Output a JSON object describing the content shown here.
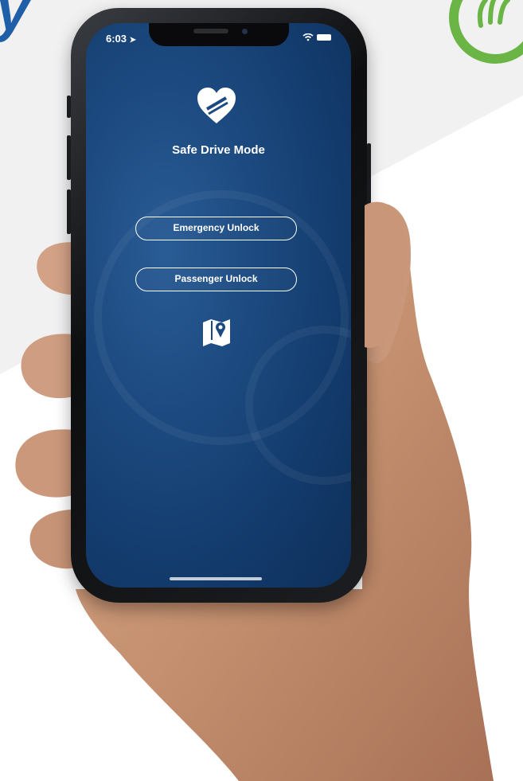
{
  "status_bar": {
    "time": "6:03"
  },
  "app": {
    "title": "Safe Drive Mode",
    "buttons": [
      {
        "label": "Emergency Unlock"
      },
      {
        "label": "Passenger Unlock"
      }
    ],
    "map_icon": "map-pin-icon",
    "logo_icon": "heart-shield-icon"
  },
  "page": {
    "corner_text": "y",
    "corner_logo_icon": "hand-icon"
  },
  "colors": {
    "screen_blue": "#1c4a80",
    "brand_green": "#6ab545",
    "heading_blue": "#1f5fa8"
  }
}
